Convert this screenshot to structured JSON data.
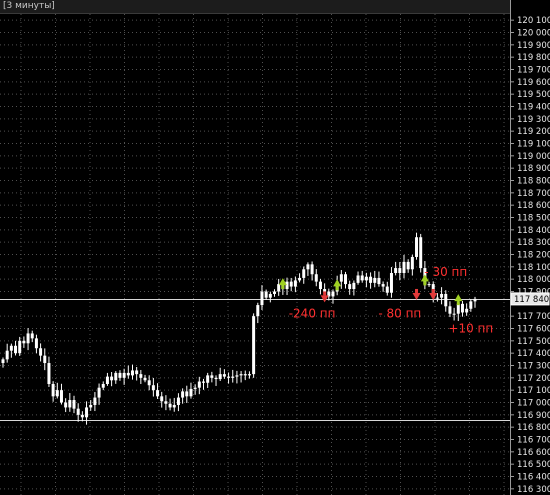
{
  "window": {
    "title": "[3 минуты]"
  },
  "colors": {
    "background": "#000000",
    "grid": "#505050",
    "candle": "#ffffff",
    "level_line": "#d8d8d8",
    "buy_arrow": "#9fd021",
    "sell_arrow": "#e23a3a",
    "annotation": "#ff3030"
  },
  "axis": {
    "y_ticks": [
      "120 100",
      "120 000",
      "119 900",
      "119 800",
      "119 700",
      "119 600",
      "119 500",
      "119 400",
      "119 300",
      "119 200",
      "119 100",
      "119 000",
      "118 900",
      "118 800",
      "118 700",
      "118 600",
      "118 500",
      "118 400",
      "118 300",
      "118 200",
      "118 100",
      "118 000",
      "117 900",
      "117 840",
      "117 700",
      "117 600",
      "117 500",
      "117 400",
      "117 300",
      "117 200",
      "117 100",
      "117 000",
      "116 900",
      "116 800",
      "116 700",
      "116 600",
      "116 500",
      "116 400",
      "116 300"
    ],
    "current_price": "117 840"
  },
  "chart_data": {
    "type": "candlestick",
    "y_range": [
      116250,
      120150
    ],
    "horizontal_levels": [
      117840,
      116860
    ],
    "closes": [
      117350,
      117420,
      117460,
      117400,
      117500,
      117480,
      117560,
      117520,
      117440,
      117380,
      117320,
      117150,
      117050,
      117100,
      117000,
      116960,
      117020,
      116950,
      116900,
      116880,
      116960,
      116980,
      117040,
      117120,
      117150,
      117210,
      117180,
      117240,
      117200,
      117240,
      117220,
      117260,
      117230,
      117200,
      117180,
      117140,
      117100,
      117050,
      117010,
      116990,
      116960,
      116980,
      117040,
      117090,
      117050,
      117110,
      117120,
      117170,
      117160,
      117220,
      117200,
      117190,
      117230,
      117210,
      117200,
      117210,
      117220,
      117230,
      117220,
      117230,
      117700,
      117790,
      117900,
      117850,
      117880,
      117900,
      117960,
      117920,
      117980,
      117940,
      117990,
      118010,
      118080,
      118120,
      118040,
      117980,
      117920,
      117900,
      117860,
      117900,
      117980,
      118040,
      117960,
      117920,
      117970,
      118030,
      117990,
      118020,
      117970,
      118010,
      117960,
      117940,
      117890,
      118050,
      118090,
      118050,
      118140,
      118080,
      118180,
      118340,
      118090,
      117960,
      117960,
      117850,
      117850,
      117880,
      117780,
      117720,
      117720,
      117800,
      117730,
      117760,
      117820,
      117840
    ],
    "trades": [
      {
        "type": "buy",
        "index": 67,
        "price": 117960
      },
      {
        "type": "sell",
        "index": 77,
        "price": 117860
      },
      {
        "type": "buy",
        "index": 80,
        "price": 117950
      },
      {
        "type": "sell",
        "index": 99,
        "price": 117880
      },
      {
        "type": "buy",
        "index": 101,
        "price": 117990
      },
      {
        "type": "sell",
        "index": 103,
        "price": 117880
      },
      {
        "type": "buy",
        "index": 109,
        "price": 117830
      }
    ],
    "annotations": [
      {
        "text": "-240 пп",
        "price": 117720,
        "index": 74
      },
      {
        "text": "- 80 пп",
        "price": 117720,
        "index": 95
      },
      {
        "text": "- 30 пп",
        "price": 118060,
        "index": 106
      },
      {
        "text": "+10 пп",
        "price": 117600,
        "index": 112
      }
    ]
  }
}
